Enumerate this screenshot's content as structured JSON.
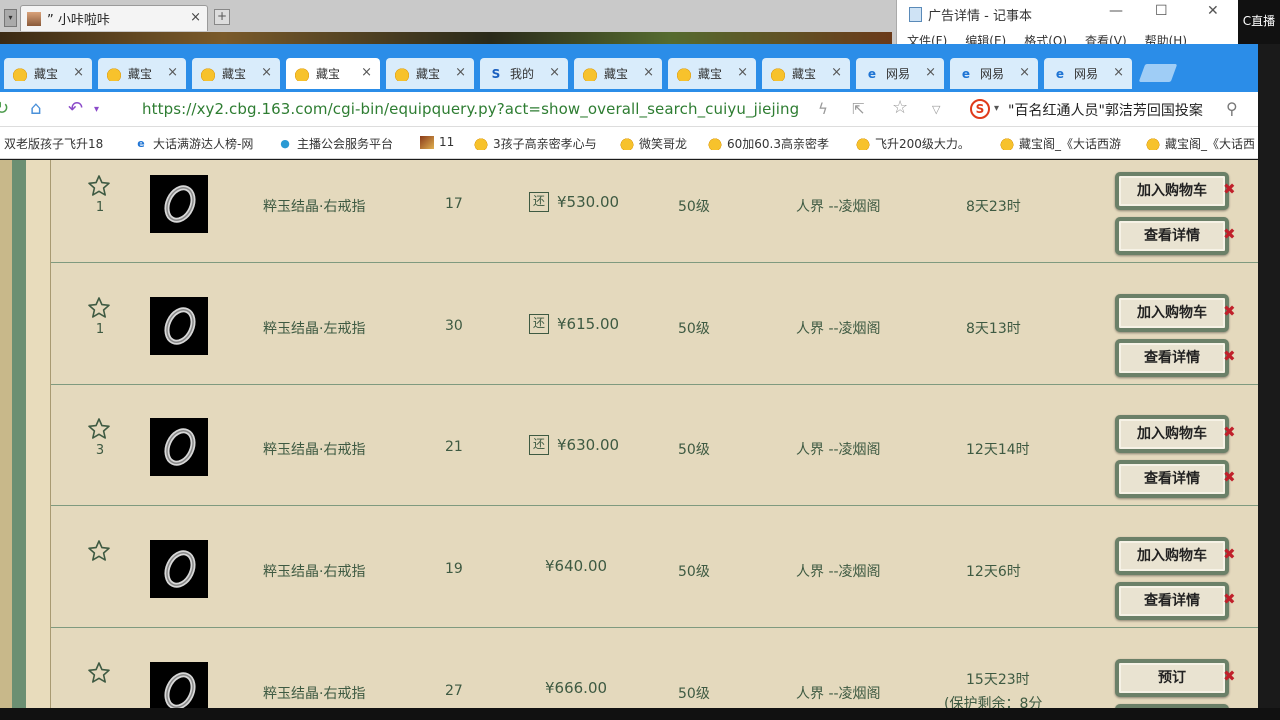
{
  "outer": {
    "tab_title": "” 小咔啦咔",
    "close": "×",
    "new_tab": "+",
    "arrow": "▾"
  },
  "notepad": {
    "title": "广告详情 - 记事本",
    "menu": [
      "文件(F)",
      "编辑(E)",
      "格式(O)",
      "查看(V)",
      "帮助(H)"
    ],
    "minimize": "—",
    "maximize": "☐",
    "close": "✕",
    "corner_text": "C直播"
  },
  "tabs": [
    {
      "label": "藏宝",
      "icon": "chick",
      "active": false
    },
    {
      "label": "藏宝",
      "icon": "chick",
      "active": false
    },
    {
      "label": "藏宝",
      "icon": "chick",
      "active": false
    },
    {
      "label": "藏宝",
      "icon": "chick",
      "active": true
    },
    {
      "label": "藏宝",
      "icon": "chick",
      "active": false
    },
    {
      "label": "我的",
      "icon": "sogou",
      "active": false
    },
    {
      "label": "藏宝",
      "icon": "chick",
      "active": false
    },
    {
      "label": "藏宝",
      "icon": "chick",
      "active": false
    },
    {
      "label": "藏宝",
      "icon": "chick",
      "active": false
    },
    {
      "label": "网易",
      "icon": "ie",
      "active": false
    },
    {
      "label": "网易",
      "icon": "ie",
      "active": false
    },
    {
      "label": "网易",
      "icon": "ie",
      "active": false
    }
  ],
  "tab_close": "×",
  "address": {
    "url": "https://xy2.cbg.163.com/cgi-bin/equipquery.py?act=show_overall_search_cuiyu_jiejing",
    "search_text": "\"百名红通人员\"郭洁芳回国投案",
    "search_engine": "S"
  },
  "bookmarks": [
    {
      "label": "双老版孩子飞升18",
      "icon": "none"
    },
    {
      "label": "大话满游达人榜-网",
      "icon": "ie"
    },
    {
      "label": "主播公会服务平台",
      "icon": "bird"
    },
    {
      "label": "11",
      "icon": "img"
    },
    {
      "label": "3孩子高亲密孝心与",
      "icon": "chick"
    },
    {
      "label": "微笑哥龙",
      "icon": "chick"
    },
    {
      "label": "60加60.3高亲密孝",
      "icon": "chick"
    },
    {
      "label": "飞升200级大力。",
      "icon": "chick"
    },
    {
      "label": "藏宝阁_《大话西游",
      "icon": "chick"
    },
    {
      "label": "藏宝阁_《大话西",
      "icon": "chick"
    }
  ],
  "buttons": {
    "add_cart": "加入购物车",
    "view_details": "查看详情",
    "reserve": "预订",
    "remove": "✖"
  },
  "huan_badge": "还",
  "rows": [
    {
      "fav_count": "1",
      "name": "粹玉结晶·右戒指",
      "level_num": "17",
      "has_badge": true,
      "price": "¥530.00",
      "grade": "50级",
      "server": "人界 --凌烟阁",
      "time": "8天23时",
      "time2": "",
      "primary": "add_cart"
    },
    {
      "fav_count": "1",
      "name": "粹玉结晶·左戒指",
      "level_num": "30",
      "has_badge": true,
      "price": "¥615.00",
      "grade": "50级",
      "server": "人界 --凌烟阁",
      "time": "8天13时",
      "time2": "",
      "primary": "add_cart"
    },
    {
      "fav_count": "3",
      "name": "粹玉结晶·右戒指",
      "level_num": "21",
      "has_badge": true,
      "price": "¥630.00",
      "grade": "50级",
      "server": "人界 --凌烟阁",
      "time": "12天14时",
      "time2": "",
      "primary": "add_cart"
    },
    {
      "fav_count": "",
      "name": "粹玉结晶·右戒指",
      "level_num": "19",
      "has_badge": false,
      "price": "¥640.00",
      "grade": "50级",
      "server": "人界 --凌烟阁",
      "time": "12天6时",
      "time2": "",
      "primary": "add_cart"
    },
    {
      "fav_count": "",
      "name": "粹玉结晶·右戒指",
      "level_num": "27",
      "has_badge": false,
      "price": "¥666.00",
      "grade": "50级",
      "server": "人界 --凌烟阁",
      "time": "15天23时",
      "time2": "(保护剩余：8分",
      "primary": "reserve"
    }
  ],
  "colors": {
    "tabbar": "#2b8de8",
    "page_bg": "#e4d9bd",
    "text": "#3e5a42",
    "url_green": "#2e7d32",
    "remove_red": "#c0202a"
  }
}
